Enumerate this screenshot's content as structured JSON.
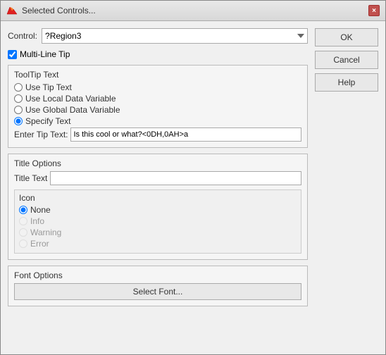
{
  "titleBar": {
    "title": "Selected Controls...",
    "closeLabel": "×",
    "logoAlt": "matlab-logo"
  },
  "control": {
    "label": "Control:",
    "value": "?Region3",
    "options": [
      "?Region3"
    ]
  },
  "multiLineTip": {
    "label": "Multi-Line Tip",
    "checked": true
  },
  "tooltipText": {
    "groupLabel": "ToolTip Text",
    "useTipText": "Use Tip Text",
    "useLocalData": "Use Local Data Variable",
    "useGlobalData": "Use Global Data Variable",
    "specifyText": "Specify Text",
    "enterTipTextLabel": "Enter Tip Text:",
    "enterTipTextValue": "Is this cool or what?<0DH,0AH>a"
  },
  "titleOptions": {
    "groupLabel": "Title Options",
    "titleTextLabel": "Title Text",
    "titleTextValue": "",
    "iconGroupLabel": "Icon",
    "icons": [
      {
        "label": "None",
        "checked": true,
        "disabled": false
      },
      {
        "label": "Info",
        "checked": false,
        "disabled": true
      },
      {
        "label": "Warning",
        "checked": false,
        "disabled": true
      },
      {
        "label": "Error",
        "checked": false,
        "disabled": true
      }
    ]
  },
  "fontOptions": {
    "groupLabel": "Font Options",
    "selectFontLabel": "Select Font..."
  },
  "buttons": {
    "ok": "OK",
    "cancel": "Cancel",
    "help": "Help"
  }
}
